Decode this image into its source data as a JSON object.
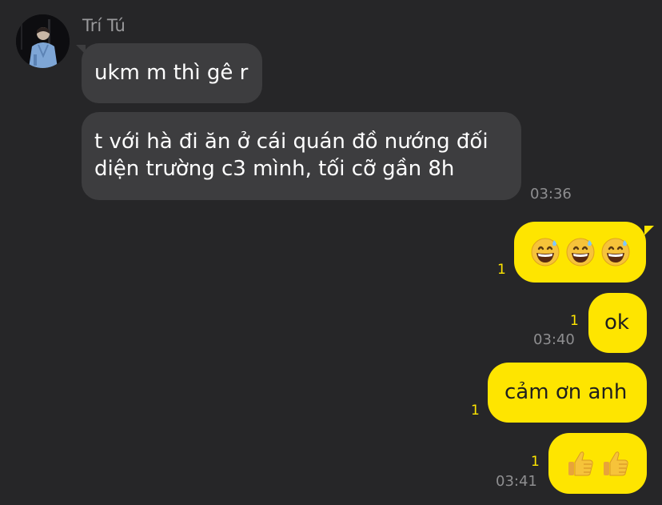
{
  "contact": {
    "name": "Trí Tú"
  },
  "incoming": [
    {
      "text": "ukm m thì gê r"
    },
    {
      "line1": "t với hà đi ăn ở cái quán đồ nướng đối",
      "line2": "diện trường c3 mình, tối cỡ gần 8h",
      "time": "03:36"
    }
  ],
  "outgoing": [
    {
      "content_type": "emoji",
      "emoji_name": "grinning-face-with-sweat",
      "count": 3,
      "unread": "1"
    },
    {
      "text": "ok",
      "unread": "1",
      "time": "03:40"
    },
    {
      "text": "cảm ơn anh",
      "unread": "1"
    },
    {
      "content_type": "emoji",
      "emoji_name": "thumbs-up",
      "count": 2,
      "unread": "1",
      "time": "03:41"
    }
  ],
  "colors": {
    "background": "#262628",
    "incoming_bubble": "#3d3d3f",
    "outgoing_bubble": "#fee500",
    "unread": "#fee500"
  }
}
